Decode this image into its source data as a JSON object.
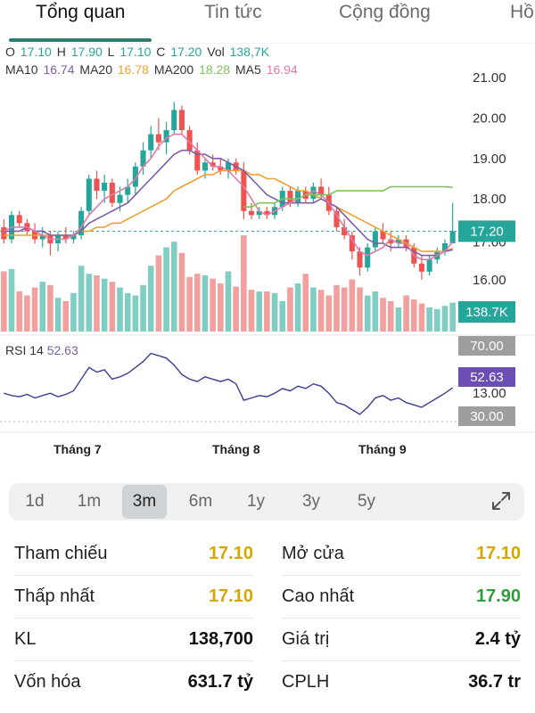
{
  "tabs": [
    {
      "label": "Tổng quan",
      "active": true
    },
    {
      "label": "Tin tức",
      "active": false
    },
    {
      "label": "Cộng đồng",
      "active": false
    },
    {
      "label": "Hồ",
      "active": false
    }
  ],
  "ohlc": {
    "o_label": "O",
    "o_value": "17.10",
    "h_label": "H",
    "h_value": "17.90",
    "l_label": "L",
    "l_value": "17.10",
    "c_label": "C",
    "c_value": "17.20",
    "vol_label": "Vol",
    "vol_value": "138,7K"
  },
  "ma": {
    "ma10_label": "MA10",
    "ma10_value": "16.74",
    "ma20_label": "MA20",
    "ma20_value": "16.78",
    "ma200_label": "MA200",
    "ma200_value": "18.28",
    "ma5_label": "MA5",
    "ma5_value": "16.94"
  },
  "rsi": {
    "label": "RSI 14",
    "value": "52.63"
  },
  "price_axis": [
    "21.00",
    "20.00",
    "19.00",
    "18.00",
    "16.00"
  ],
  "price_axis_partial": "17.00",
  "rsi_axis_partial": [
    "14.00",
    "13.00"
  ],
  "current_price_tag": "17.20",
  "volume_tag": "138.7K",
  "rsi_tags": {
    "upper": "70.00",
    "current": "52.63",
    "lower": "30.00"
  },
  "months": [
    "Tháng 7",
    "Tháng 8",
    "Tháng 9"
  ],
  "ranges": [
    {
      "label": "1d",
      "active": false
    },
    {
      "label": "1m",
      "active": false
    },
    {
      "label": "3m",
      "active": true
    },
    {
      "label": "6m",
      "active": false
    },
    {
      "label": "1y",
      "active": false
    },
    {
      "label": "3y",
      "active": false
    },
    {
      "label": "5y",
      "active": false
    }
  ],
  "stats": {
    "tham_chieu": {
      "label": "Tham chiếu",
      "value": "17.10"
    },
    "mo_cua": {
      "label": "Mở cửa",
      "value": "17.10"
    },
    "thap_nhat": {
      "label": "Thấp nhất",
      "value": "17.10"
    },
    "cao_nhat": {
      "label": "Cao nhất",
      "value": "17.90"
    },
    "kl": {
      "label": "KL",
      "value": "138,700"
    },
    "gia_tri": {
      "label": "Giá trị",
      "value": "2.4 tỷ"
    },
    "von_hoa": {
      "label": "Vốn hóa",
      "value": "631.7 tỷ"
    },
    "cplh": {
      "label": "CPLH",
      "value": "36.7 tr"
    }
  },
  "colors": {
    "up": "#26a69a",
    "down": "#ef5350",
    "ma10": "#7b5ea7",
    "ma20": "#f0a030",
    "ma200": "#7cc35a",
    "ma5": "#e07aa8",
    "reference": "#d4a800",
    "high": "#2e9e3a",
    "accent": "#2e7d6e"
  },
  "chart_data": {
    "type": "candlestick",
    "ylim": [
      15.6,
      21.2
    ],
    "candles": [
      [
        17.3,
        17.5,
        16.9,
        17.0
      ],
      [
        17.0,
        17.7,
        16.9,
        17.6
      ],
      [
        17.6,
        17.7,
        17.3,
        17.4
      ],
      [
        17.4,
        17.5,
        17.1,
        17.2
      ],
      [
        17.2,
        17.4,
        16.9,
        17.0
      ],
      [
        17.0,
        17.3,
        16.8,
        17.1
      ],
      [
        17.1,
        17.2,
        16.6,
        16.9
      ],
      [
        16.9,
        17.2,
        16.7,
        17.1
      ],
      [
        17.1,
        17.3,
        16.9,
        17.0
      ],
      [
        17.0,
        17.2,
        16.9,
        17.1
      ],
      [
        17.1,
        17.8,
        17.0,
        17.7
      ],
      [
        17.7,
        18.6,
        17.6,
        18.5
      ],
      [
        18.5,
        18.7,
        18.0,
        18.2
      ],
      [
        18.2,
        18.6,
        17.9,
        18.4
      ],
      [
        18.4,
        18.5,
        17.8,
        17.9
      ],
      [
        17.9,
        18.3,
        17.7,
        18.1
      ],
      [
        18.1,
        18.5,
        17.9,
        18.3
      ],
      [
        18.3,
        18.9,
        18.1,
        18.8
      ],
      [
        18.8,
        19.4,
        18.6,
        19.2
      ],
      [
        19.2,
        19.8,
        19.0,
        19.6
      ],
      [
        19.6,
        20.0,
        19.2,
        19.4
      ],
      [
        19.4,
        19.9,
        19.1,
        19.7
      ],
      [
        19.7,
        20.4,
        19.6,
        20.2
      ],
      [
        20.2,
        20.3,
        19.6,
        19.7
      ],
      [
        19.7,
        19.8,
        19.1,
        19.2
      ],
      [
        19.2,
        19.4,
        18.6,
        18.7
      ],
      [
        18.7,
        19.0,
        18.5,
        18.9
      ],
      [
        18.9,
        19.1,
        18.7,
        18.8
      ],
      [
        18.8,
        19.0,
        18.6,
        18.7
      ],
      [
        18.7,
        19.0,
        18.5,
        18.9
      ],
      [
        18.9,
        19.0,
        18.6,
        18.7
      ],
      [
        18.7,
        18.9,
        17.5,
        17.7
      ],
      [
        17.7,
        17.9,
        17.5,
        17.6
      ],
      [
        17.6,
        17.8,
        17.5,
        17.7
      ],
      [
        17.7,
        17.8,
        17.5,
        17.6
      ],
      [
        17.6,
        17.9,
        17.5,
        17.8
      ],
      [
        17.8,
        18.3,
        17.7,
        18.2
      ],
      [
        18.2,
        18.3,
        17.8,
        17.9
      ],
      [
        17.9,
        18.3,
        17.8,
        18.2
      ],
      [
        18.2,
        18.3,
        17.9,
        18.0
      ],
      [
        18.0,
        18.4,
        17.9,
        18.3
      ],
      [
        18.3,
        18.5,
        18.0,
        18.1
      ],
      [
        18.1,
        18.3,
        17.6,
        17.7
      ],
      [
        17.7,
        17.8,
        17.2,
        17.3
      ],
      [
        17.3,
        17.5,
        17.0,
        17.1
      ],
      [
        17.1,
        17.2,
        16.5,
        16.7
      ],
      [
        16.7,
        16.8,
        16.1,
        16.3
      ],
      [
        16.3,
        16.9,
        16.2,
        16.8
      ],
      [
        16.8,
        17.3,
        16.7,
        17.2
      ],
      [
        17.2,
        17.4,
        16.9,
        17.0
      ],
      [
        17.0,
        17.2,
        16.7,
        16.9
      ],
      [
        16.9,
        17.1,
        16.8,
        17.0
      ],
      [
        17.0,
        17.1,
        16.7,
        16.8
      ],
      [
        16.8,
        16.9,
        16.3,
        16.4
      ],
      [
        16.4,
        16.6,
        16.0,
        16.2
      ],
      [
        16.2,
        16.6,
        16.1,
        16.5
      ],
      [
        16.5,
        16.8,
        16.4,
        16.7
      ],
      [
        16.7,
        17.0,
        16.6,
        16.9
      ],
      [
        16.9,
        17.9,
        16.9,
        17.2
      ]
    ],
    "volumes": [
      75,
      78,
      50,
      45,
      55,
      62,
      58,
      42,
      38,
      48,
      82,
      72,
      70,
      66,
      62,
      55,
      48,
      45,
      58,
      82,
      95,
      105,
      112,
      98,
      68,
      72,
      70,
      66,
      60,
      75,
      56,
      120,
      52,
      50,
      50,
      48,
      38,
      55,
      60,
      72,
      55,
      52,
      45,
      58,
      55,
      65,
      55,
      45,
      50,
      42,
      38,
      30,
      45,
      40,
      35,
      30,
      28,
      32,
      36
    ],
    "rsi": [
      48,
      46,
      45,
      47,
      44,
      46,
      48,
      45,
      47,
      50,
      60,
      70,
      66,
      68,
      60,
      62,
      65,
      70,
      75,
      82,
      80,
      78,
      72,
      64,
      60,
      58,
      62,
      60,
      58,
      60,
      56,
      42,
      44,
      46,
      45,
      48,
      52,
      50,
      54,
      52,
      56,
      54,
      48,
      40,
      38,
      34,
      30,
      36,
      44,
      46,
      42,
      44,
      40,
      38,
      36,
      40,
      44,
      48,
      52.63
    ],
    "ma10": [
      17.2,
      17.2,
      17.2,
      17.3,
      17.2,
      17.2,
      17.1,
      17.1,
      17.1,
      17.1,
      17.2,
      17.4,
      17.5,
      17.6,
      17.7,
      17.8,
      17.9,
      18.1,
      18.3,
      18.5,
      18.7,
      18.9,
      19.1,
      19.2,
      19.2,
      19.1,
      19.1,
      19.0,
      19.0,
      18.9,
      18.8,
      18.7,
      18.5,
      18.3,
      18.1,
      18.0,
      17.9,
      17.9,
      17.9,
      17.9,
      17.9,
      18.0,
      17.9,
      17.8,
      17.6,
      17.4,
      17.2,
      17.0,
      16.9,
      16.9,
      16.8,
      16.8,
      16.8,
      16.7,
      16.6,
      16.6,
      16.6,
      16.7,
      16.74
    ],
    "ma20": [
      17.1,
      17.1,
      17.1,
      17.1,
      17.1,
      17.1,
      17.1,
      17.1,
      17.1,
      17.1,
      17.2,
      17.2,
      17.3,
      17.3,
      17.4,
      17.4,
      17.5,
      17.6,
      17.7,
      17.8,
      17.9,
      18.0,
      18.2,
      18.3,
      18.4,
      18.5,
      18.6,
      18.6,
      18.7,
      18.7,
      18.7,
      18.7,
      18.6,
      18.6,
      18.5,
      18.5,
      18.4,
      18.3,
      18.2,
      18.2,
      18.1,
      18.0,
      17.9,
      17.8,
      17.7,
      17.6,
      17.5,
      17.4,
      17.3,
      17.2,
      17.1,
      17.0,
      16.9,
      16.8,
      16.7,
      16.7,
      16.7,
      16.7,
      16.78
    ],
    "ma200": [
      17.8,
      17.8,
      17.9,
      17.9,
      17.9,
      18.0,
      18.0,
      18.0,
      18.1,
      18.1,
      18.1,
      18.1,
      18.2,
      18.2,
      18.2,
      18.2,
      18.2,
      18.2,
      18.2,
      18.3,
      18.3,
      18.3,
      18.3,
      18.3,
      18.3,
      18.3,
      18.3,
      18.28
    ],
    "ma200_start": 31,
    "ma5": [
      17.2,
      17.3,
      17.3,
      17.3,
      17.2,
      17.1,
      17.0,
      17.0,
      17.0,
      17.1,
      17.3,
      17.6,
      17.8,
      18.0,
      18.1,
      18.2,
      18.3,
      18.5,
      18.8,
      19.0,
      19.3,
      19.5,
      19.6,
      19.6,
      19.4,
      19.2,
      19.0,
      18.8,
      18.8,
      18.7,
      18.5,
      18.3,
      18.0,
      17.7,
      17.6,
      17.7,
      17.8,
      17.9,
      18.0,
      18.1,
      18.2,
      18.1,
      17.9,
      17.6,
      17.3,
      17.0,
      16.7,
      16.6,
      16.7,
      16.8,
      17.0,
      16.9,
      16.9,
      16.6,
      16.5,
      16.5,
      16.6,
      16.7,
      16.94
    ]
  }
}
